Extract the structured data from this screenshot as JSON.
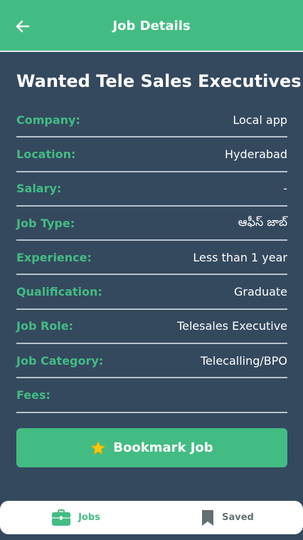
{
  "header": {
    "title": "Job Details",
    "back_icon": "arrow-left-icon"
  },
  "job": {
    "title": "Wanted Tele Sales Executives",
    "details": [
      {
        "label": "Company:",
        "value": "Local app"
      },
      {
        "label": "Location:",
        "value": "Hyderabad"
      },
      {
        "label": "Salary:",
        "value": "-"
      },
      {
        "label": "Job Type:",
        "value": "ఆఫీస్ జాబ్"
      },
      {
        "label": "Experience:",
        "value": "Less than 1 year"
      },
      {
        "label": "Qualification:",
        "value": "Graduate"
      },
      {
        "label": "Job Role:",
        "value": "Telesales Executive"
      },
      {
        "label": "Job Category:",
        "value": "Telecalling/BPO"
      },
      {
        "label": "Fees:",
        "value": ""
      }
    ]
  },
  "actions": {
    "bookmark_label": "Bookmark Job",
    "bookmark_icon": "star-icon"
  },
  "bottom_nav": {
    "items": [
      {
        "label": "Jobs",
        "icon": "briefcase-icon",
        "active": true
      },
      {
        "label": "Saved",
        "icon": "bookmark-icon",
        "active": false
      }
    ]
  },
  "colors": {
    "accent": "#43bc83",
    "background": "#34495e",
    "divider": "#b7c2ce",
    "star": "#f9c80e"
  }
}
